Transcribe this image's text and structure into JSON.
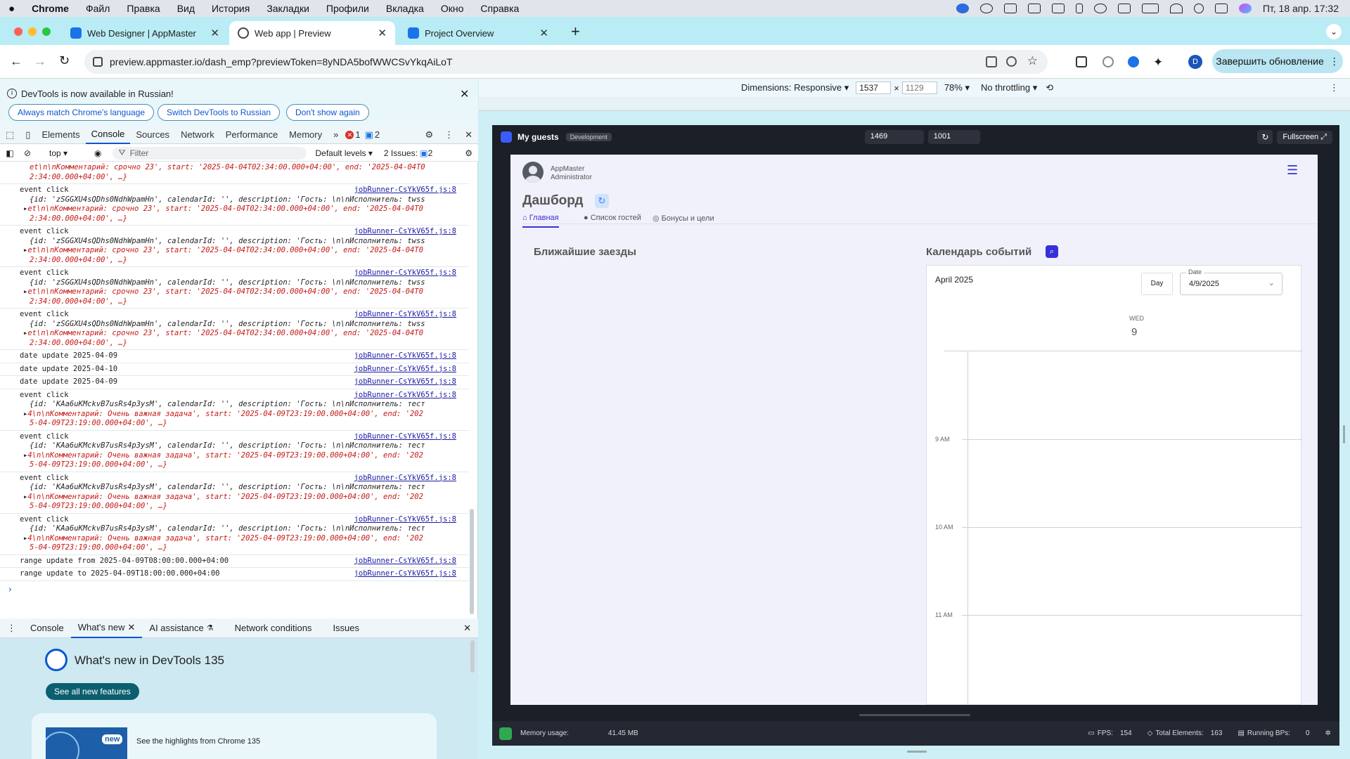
{
  "menubar": {
    "apple": "",
    "app": "Chrome",
    "items": [
      "Файл",
      "Правка",
      "Вид",
      "История",
      "Закладки",
      "Профили",
      "Вкладка",
      "Окно",
      "Справка"
    ],
    "clock": "Пт, 18 апр.  17:32"
  },
  "tabs": [
    {
      "title": "Web Designer | AppMaster"
    },
    {
      "title": "Web app | Preview"
    },
    {
      "title": "Project Overview"
    }
  ],
  "toolbar": {
    "url": "preview.appmaster.io/dash_emp?previewToken=8yNDA5bofWWCSvYkqAiLoT",
    "update_btn": "Завершить обновление",
    "profile": "D"
  },
  "devtools": {
    "info": {
      "text": "DevTools is now available in Russian!",
      "btn1": "Always match Chrome's language",
      "btn2": "Switch DevTools to Russian",
      "btn3": "Don't show again"
    },
    "tabs": [
      "Elements",
      "Console",
      "Sources",
      "Network",
      "Performance",
      "Memory"
    ],
    "errors": "1",
    "warnings": "2",
    "console_toolbar": {
      "context": "top",
      "filter": "Filter",
      "levels": "Default levels",
      "issues": "2 Issues:",
      "issues_count": "2"
    },
    "src": "jobRunner-CsYkV65f.js:8",
    "logs": [
      {
        "type": "cont",
        "line1": "et\\n\\nКомментарий: срочно 23', start: '2025-04-04T02:34:00.000+04:00', end: '2025-04-04T0",
        "line2": "2:34:00.000+04:00', …}"
      },
      {
        "type": "event",
        "title": "event click",
        "line0": "{id: 'zSGGXU4sQDhs0NdhWpamHn', calendarId: '', description: 'Гость: \\n\\nИсполнитель: twss",
        "line1": "et\\n\\nКомментарий: срочно 23', start: '2025-04-04T02:34:00.000+04:00', end: '2025-04-04T0",
        "line2": "2:34:00.000+04:00', …}"
      },
      {
        "type": "event",
        "title": "event click",
        "line0": "{id: 'zSGGXU4sQDhs0NdhWpamHn', calendarId: '', description: 'Гость: \\n\\nИсполнитель: twss",
        "line1": "et\\n\\nКомментарий: срочно 23', start: '2025-04-04T02:34:00.000+04:00', end: '2025-04-04T0",
        "line2": "2:34:00.000+04:00', …}"
      },
      {
        "type": "event",
        "title": "event click",
        "line0": "{id: 'zSGGXU4sQDhs0NdhWpamHn', calendarId: '', description: 'Гость: \\n\\nИсполнитель: twss",
        "line1": "et\\n\\nКомментарий: срочно 23', start: '2025-04-04T02:34:00.000+04:00', end: '2025-04-04T0",
        "line2": "2:34:00.000+04:00', …}"
      },
      {
        "type": "event",
        "title": "event click",
        "line0": "{id: 'zSGGXU4sQDhs0NdhWpamHn', calendarId: '', description: 'Гость: \\n\\nИсполнитель: twss",
        "line1": "et\\n\\nКомментарий: срочно 23', start: '2025-04-04T02:34:00.000+04:00', end: '2025-04-04T0",
        "line2": "2:34:00.000+04:00', …}"
      },
      {
        "type": "plain",
        "title": "date update 2025-04-09"
      },
      {
        "type": "plain",
        "title": "date update 2025-04-10"
      },
      {
        "type": "plain",
        "title": "date update 2025-04-09"
      },
      {
        "type": "event",
        "title": "event click",
        "line0": "{id: 'KAa6uKMckvB7usRs4p3ysM', calendarId: '', description: 'Гость: \\n\\nИсполнитель: тест",
        "line1": "4\\n\\nКомментарий: Очень важная задача', start: '2025-04-09T23:19:00.000+04:00', end: '202",
        "line2": "5-04-09T23:19:00.000+04:00', …}"
      },
      {
        "type": "event",
        "title": "event click",
        "line0": "{id: 'KAa6uKMckvB7usRs4p3ysM', calendarId: '', description: 'Гость: \\n\\nИсполнитель: тест",
        "line1": "4\\n\\nКомментарий: Очень важная задача', start: '2025-04-09T23:19:00.000+04:00', end: '202",
        "line2": "5-04-09T23:19:00.000+04:00', …}"
      },
      {
        "type": "event",
        "title": "event click",
        "line0": "{id: 'KAa6uKMckvB7usRs4p3ysM', calendarId: '', description: 'Гость: \\n\\nИсполнитель: тест",
        "line1": "4\\n\\nКомментарий: Очень важная задача', start: '2025-04-09T23:19:00.000+04:00', end: '202",
        "line2": "5-04-09T23:19:00.000+04:00', …}"
      },
      {
        "type": "event",
        "title": "event click",
        "line0": "{id: 'KAa6uKMckvB7usRs4p3ysM', calendarId: '', description: 'Гость: \\n\\nИсполнитель: тест",
        "line1": "4\\n\\nКомментарий: Очень важная задача', start: '2025-04-09T23:19:00.000+04:00', end: '202",
        "line2": "5-04-09T23:19:00.000+04:00', …}"
      },
      {
        "type": "plain",
        "title": "range update from 2025-04-09T08:00:00.000+04:00"
      },
      {
        "type": "plain",
        "title": "range update to 2025-04-09T18:00:00.000+04:00"
      }
    ],
    "prompt": "›",
    "drawer": {
      "tabs": [
        "Console",
        "What's new",
        "AI assistance",
        "Network conditions",
        "Issues"
      ],
      "whatsnew_title": "What's new in DevTools 135",
      "see_all": "See all new features",
      "badge": "new",
      "highlight": "See the highlights from Chrome 135"
    }
  },
  "device": {
    "dimensions": "Dimensions: Responsive",
    "width": "1537",
    "height": "1129",
    "zoom": "78%",
    "throttle": "No throttling"
  },
  "app": {
    "name": "My guests",
    "env": "Development",
    "w": "1469",
    "h": "1001",
    "fullscreen": "Fullscreen",
    "user": {
      "name": "AppMaster",
      "role": "Administrator"
    },
    "title": "Дашборд",
    "tabs": [
      "Главная",
      "Список гостей",
      "Бонусы и цели"
    ],
    "left_heading": "Ближайшие заезды",
    "right_heading": "Календарь событий",
    "calendar": {
      "month": "April 2025",
      "view": "Day",
      "date_label": "Date",
      "date": "4/9/2025",
      "dow": "WED",
      "day": "9",
      "times": [
        "9 AM",
        "10 AM",
        "11 AM"
      ]
    },
    "footer": {
      "memory_label": "Memory usage:",
      "memory": "41.45 MB",
      "fps_label": "FPS:",
      "fps": "154",
      "elements_label": "Total Elements:",
      "elements": "163",
      "bps_label": "Running BPs:",
      "bps": "0"
    }
  },
  "colors": {
    "accent": "#0b57d0",
    "app_primary": "#3730d9",
    "error": "#d93025"
  }
}
